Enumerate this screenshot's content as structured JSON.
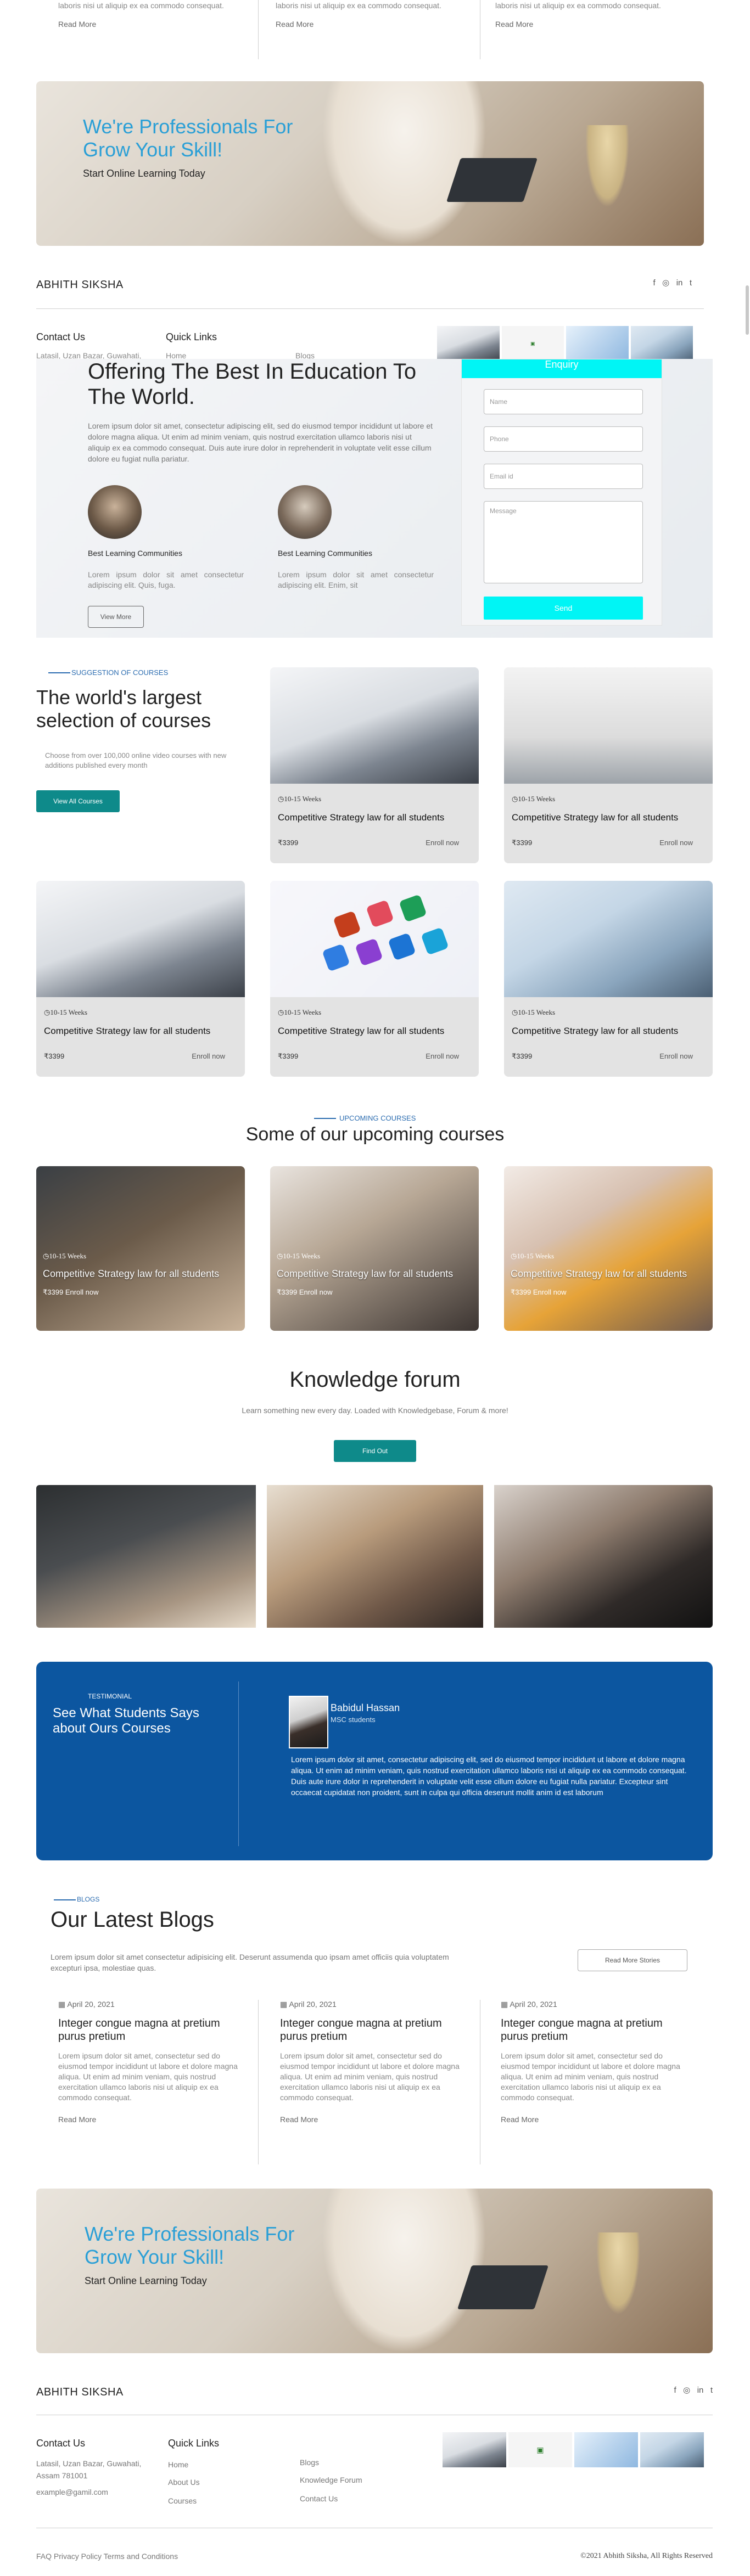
{
  "top_snippets": [
    {
      "text": "laboris nisi ut aliquip ex ea commodo consequat.",
      "link": "Read More"
    },
    {
      "text": "laboris nisi ut aliquip ex ea commodo consequat.",
      "link": "Read More"
    },
    {
      "text": "laboris nisi ut aliquip ex ea commodo consequat.",
      "link": "Read More"
    }
  ],
  "promo_banner": {
    "headline_1": "We're Professionals For",
    "headline_2": "Grow Your Skill!",
    "subtitle": "Start Online Learning Today"
  },
  "footer_1": {
    "brand": "ABHITH SIKSHA",
    "contact_heading": "Contact Us",
    "address": "Latasil, Uzan Bazar, Guwahati,",
    "quick_links_heading": "Quick Links",
    "quick_link_home": "Home",
    "quick_link_blogs": "Blogs"
  },
  "hero": {
    "title": "Offering The Best In Education To The World.",
    "body": "Lorem ipsum dolor sit amet, consectetur adipiscing elit, sed do eiusmod tempor incididunt ut labore et dolore magna aliqua. Ut enim ad minim veniam, quis nostrud exercitation ullamco laboris nisi ut aliquip ex ea commodo consequat. Duis aute irure dolor in reprehenderit in voluptate velit esse cillum dolore eu fugiat nulla pariatur.",
    "features": [
      {
        "title": "Best Learning Communities",
        "text": "Lorem ipsum dolor sit amet consectetur adipiscing elit. Quis, fuga."
      },
      {
        "title": "Best Learning Communities",
        "text": "Lorem ipsum dolor sit amet consectetur adipiscing elit. Enim, sit"
      }
    ],
    "view_more": "View More"
  },
  "enquiry": {
    "heading": "Enquiry",
    "name_placeholder": "Name",
    "phone_placeholder": "Phone",
    "email_placeholder": "Email id",
    "message_placeholder": "Message",
    "send_label": "Send"
  },
  "courses": {
    "eyebrow": "SUGGESTION OF COURSES",
    "title": "The world's largest selection of courses",
    "subtitle": "Choose from over 100,000 online video courses with new additions published every month",
    "button": "View All Courses",
    "items": [
      {
        "weeks": "10-15 Weeks",
        "title": "Competitive Strategy law for all students",
        "price": "₹3399",
        "enroll": "Enroll now"
      },
      {
        "weeks": "10-15 Weeks",
        "title": "Competitive Strategy law for all students",
        "price": "₹3399",
        "enroll": "Enroll now"
      },
      {
        "weeks": "10-15 Weeks",
        "title": "Competitive Strategy law for all students",
        "price": "₹3399",
        "enroll": "Enroll now"
      },
      {
        "weeks": "10-15 Weeks",
        "title": "Competitive Strategy law for all students",
        "price": "₹3399",
        "enroll": "Enroll now"
      },
      {
        "weeks": "10-15 Weeks",
        "title": "Competitive Strategy law for all students",
        "price": "₹3399",
        "enroll": "Enroll now"
      }
    ]
  },
  "upcoming": {
    "eyebrow": "UPCOMING COURSES",
    "title": "Some of our upcoming courses",
    "items": [
      {
        "weeks": "10-15 Weeks",
        "title": "Competitive Strategy law for all students",
        "price": "₹3399",
        "enroll": "Enroll now"
      },
      {
        "weeks": "10-15 Weeks",
        "title": "Competitive Strategy law for all students",
        "price": "₹3399",
        "enroll": "Enroll now"
      },
      {
        "weeks": "10-15 Weeks",
        "title": "Competitive Strategy law for all students",
        "price": "₹3399",
        "enroll": "Enroll now"
      }
    ]
  },
  "forum": {
    "title": "Knowledge forum",
    "subtitle": "Learn something new every day. Loaded with Knowledgebase, Forum & more!",
    "button": "Find Out"
  },
  "testimonial": {
    "eyebrow": "TESTIMONIAL",
    "heading": "See What Students Says about Ours Courses",
    "name": "Babidul Hassan",
    "role": "MSC students",
    "quote": "Lorem ipsum dolor sit amet, consectetur adipiscing elit, sed do eiusmod tempor incididunt ut labore et dolore magna aliqua. Ut enim ad minim veniam, quis nostrud exercitation ullamco laboris nisi ut aliquip ex ea commodo consequat. Duis aute irure dolor in reprehenderit in voluptate velit esse cillum dolore eu fugiat nulla pariatur. Excepteur sint occaecat cupidatat non proident, sunt in culpa qui officia deserunt mollit anim id est laborum"
  },
  "blogs": {
    "eyebrow": "BLOGS",
    "title": "Our Latest Blogs",
    "intro": "Lorem ipsum dolor sit amet consectetur adipisicing elit. Deserunt assumenda quo ipsam amet officiis quia voluptatem excepturi ipsa, molestiae quas.",
    "more_button": "Read More Stories",
    "items": [
      {
        "date": "April 20, 2021",
        "title": "Integer congue magna at pretium purus pretium",
        "text": "Lorem ipsum dolor sit amet, consectetur sed do eiusmod tempor incididunt ut labore et dolore magna aliqua. Ut enim ad minim veniam, quis nostrud exercitation ullamco laboris nisi ut aliquip ex ea commodo consequat.",
        "link": "Read More"
      },
      {
        "date": "April 20, 2021",
        "title": "Integer congue magna at pretium purus pretium",
        "text": "Lorem ipsum dolor sit amet, consectetur sed do eiusmod tempor incididunt ut labore et dolore magna aliqua. Ut enim ad minim veniam, quis nostrud exercitation ullamco laboris nisi ut aliquip ex ea commodo consequat.",
        "link": "Read More"
      },
      {
        "date": "April 20, 2021",
        "title": "Integer congue magna at pretium purus pretium",
        "text": "Lorem ipsum dolor sit amet, consectetur sed do eiusmod tempor incididunt ut labore et dolore magna aliqua. Ut enim ad minim veniam, quis nostrud exercitation ullamco laboris nisi ut aliquip ex ea commodo consequat.",
        "link": "Read More"
      }
    ]
  },
  "footer_2": {
    "brand": "ABHITH SIKSHA",
    "contact_heading": "Contact Us",
    "address": "Latasil, Uzan Bazar, Guwahati, Assam 781001",
    "email": "example@gamil.com",
    "quick_links_heading": "Quick Links",
    "links_col1": [
      "Home",
      "About Us",
      "Courses"
    ],
    "links_col2": [
      "Blogs",
      "Knowledge Forum",
      "Contact Us"
    ],
    "bottom_left": "FAQ Privacy Policy Terms and Conditions",
    "bottom_right": "©2021 Abhith Siksha, All Rights Reserved"
  },
  "colors": {
    "accent_teal": "#0e8a8a",
    "cyan": "#00f5f5",
    "testimonial_blue": "#0c56a0",
    "heading_blue": "#2a9fd6"
  }
}
